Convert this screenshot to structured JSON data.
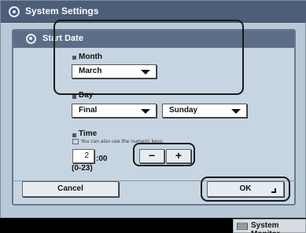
{
  "window": {
    "title": "System Settings"
  },
  "dialog": {
    "title": "Start Date",
    "month": {
      "label": "Month",
      "value": "March"
    },
    "day": {
      "label": "Day",
      "week_value": "Final",
      "weekday_value": "Sunday"
    },
    "time": {
      "label": "Time",
      "hint": "You can also use the numeric keys.",
      "hour_value": "2",
      "minutes_suffix": ":00",
      "range": "(0-23)",
      "minus_label": "−",
      "plus_label": "+"
    },
    "cancel_label": "Cancel",
    "ok_label": "OK"
  },
  "footer": {
    "system_monitor_label": "System Monitor"
  }
}
